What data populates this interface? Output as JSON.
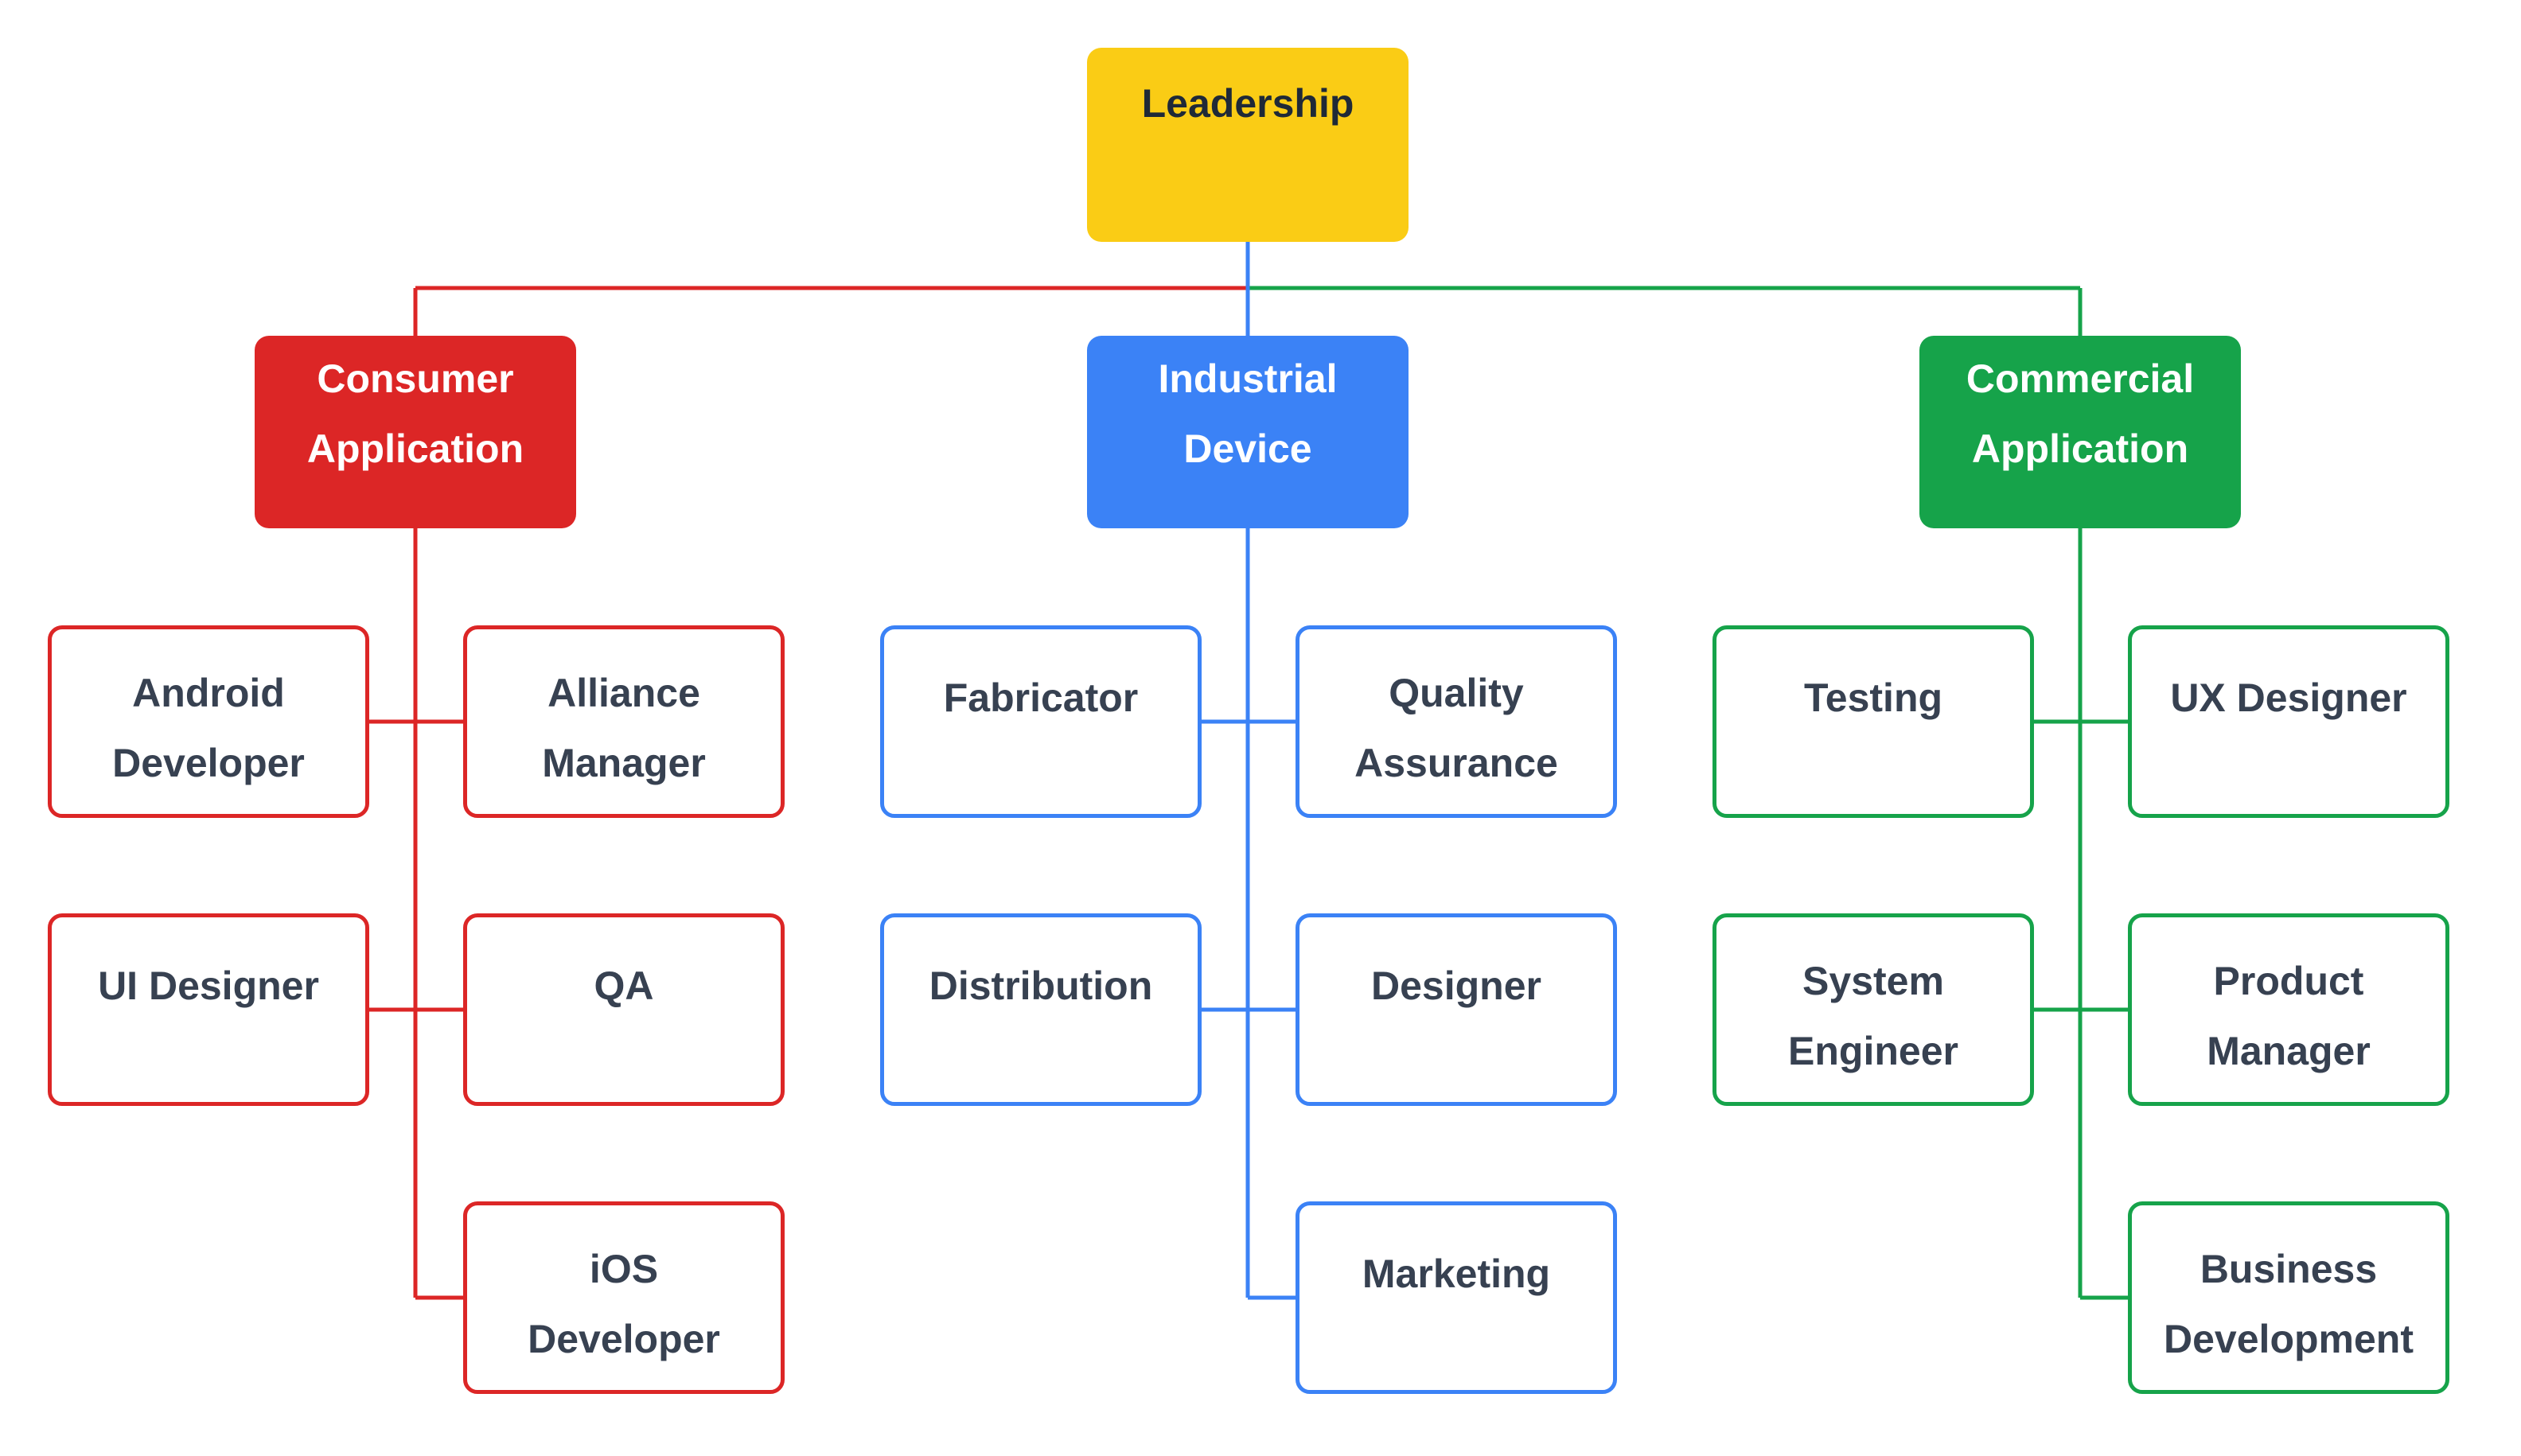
{
  "colors": {
    "leadership": "#FACC15",
    "consumer": "#DC2626",
    "industrial": "#3B82F6",
    "commercial": "#16A34A",
    "text_dark": "#374151",
    "text_light": "#FFFFFF"
  },
  "root": {
    "label": "Leadership"
  },
  "departments": [
    {
      "id": "consumer",
      "label_lines": [
        "Consumer",
        "Application"
      ],
      "children": [
        {
          "label_lines": [
            "Android",
            "Developer"
          ]
        },
        {
          "label_lines": [
            "Alliance",
            "Manager"
          ]
        },
        {
          "label_lines": [
            "UI Designer"
          ]
        },
        {
          "label_lines": [
            "QA"
          ]
        },
        {
          "label_lines": [
            "iOS",
            "Developer"
          ]
        }
      ]
    },
    {
      "id": "industrial",
      "label_lines": [
        "Industrial",
        "Device"
      ],
      "children": [
        {
          "label_lines": [
            "Fabricator"
          ]
        },
        {
          "label_lines": [
            "Quality",
            "Assurance"
          ]
        },
        {
          "label_lines": [
            "Distribution"
          ]
        },
        {
          "label_lines": [
            "Designer"
          ]
        },
        {
          "label_lines": [
            "Marketing"
          ]
        }
      ]
    },
    {
      "id": "commercial",
      "label_lines": [
        "Commercial",
        "Application"
      ],
      "children": [
        {
          "label_lines": [
            "Testing"
          ]
        },
        {
          "label_lines": [
            "UX Designer"
          ]
        },
        {
          "label_lines": [
            "System",
            "Engineer"
          ]
        },
        {
          "label_lines": [
            "Product",
            "Manager"
          ]
        },
        {
          "label_lines": [
            "Business",
            "Development"
          ]
        }
      ]
    }
  ]
}
